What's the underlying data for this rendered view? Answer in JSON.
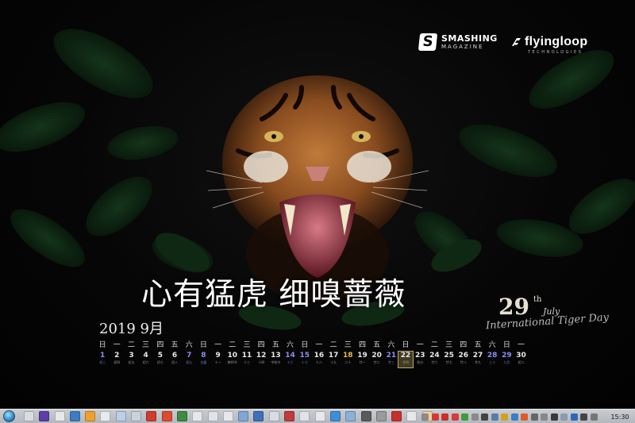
{
  "wallpaper": {
    "slogan": "心有猛虎 细嗅蔷薇",
    "logos": {
      "smashing_mark": "S",
      "smashing_line1": "SMASHING",
      "smashing_line2": "MAGAZINE",
      "flyingloop_name": "flyingloop",
      "flyingloop_tagline": "TECHNOLOGIES"
    },
    "tiger_day": {
      "number": "29",
      "suffix": "th",
      "month": "July",
      "caption": "International Tiger Day"
    }
  },
  "calendar": {
    "title": "2019 9月",
    "weekdays": [
      "日",
      "一",
      "二",
      "三",
      "四",
      "五",
      "六",
      "日",
      "一",
      "二",
      "三",
      "四",
      "五",
      "六",
      "日",
      "一",
      "二",
      "三",
      "四",
      "五",
      "六",
      "日",
      "一",
      "二",
      "三",
      "四",
      "五",
      "六",
      "日",
      "一"
    ],
    "days": [
      {
        "n": "1",
        "s": "初三",
        "weekend": true
      },
      {
        "n": "2",
        "s": "初四"
      },
      {
        "n": "3",
        "s": "初五"
      },
      {
        "n": "4",
        "s": "初六"
      },
      {
        "n": "5",
        "s": "初七"
      },
      {
        "n": "6",
        "s": "初八"
      },
      {
        "n": "7",
        "s": "初九",
        "weekend": true
      },
      {
        "n": "8",
        "s": "白露",
        "weekend": true
      },
      {
        "n": "9",
        "s": "十一"
      },
      {
        "n": "10",
        "s": "教师节"
      },
      {
        "n": "11",
        "s": "十三"
      },
      {
        "n": "12",
        "s": "十四"
      },
      {
        "n": "13",
        "s": "中秋节"
      },
      {
        "n": "14",
        "s": "十六",
        "weekend": true
      },
      {
        "n": "15",
        "s": "十七",
        "weekend": true
      },
      {
        "n": "16",
        "s": "十八"
      },
      {
        "n": "17",
        "s": "十九"
      },
      {
        "n": "18",
        "s": "二十",
        "holiday": true
      },
      {
        "n": "19",
        "s": "廿一"
      },
      {
        "n": "20",
        "s": "廿二"
      },
      {
        "n": "21",
        "s": "廿三",
        "weekend": true
      },
      {
        "n": "22",
        "s": "廿四",
        "today": true
      },
      {
        "n": "23",
        "s": "秋分"
      },
      {
        "n": "24",
        "s": "廿六"
      },
      {
        "n": "25",
        "s": "廿七"
      },
      {
        "n": "26",
        "s": "廿八"
      },
      {
        "n": "27",
        "s": "廿九"
      },
      {
        "n": "28",
        "s": "三十",
        "weekend": true
      },
      {
        "n": "29",
        "s": "九月",
        "weekend": true
      },
      {
        "n": "30",
        "s": "初二"
      }
    ]
  },
  "taskbar": {
    "clock": "15:30",
    "app_icon_colors": [
      "#d9dde2",
      "#5b3fa6",
      "#e6e8eb",
      "#3b7cc4",
      "#f0a02a",
      "#e9eaec",
      "#b8d0e8",
      "#c9d3de",
      "#d23b2e",
      "#e04a2e",
      "#3f8a3f",
      "#e6e8eb",
      "#dfe3e8",
      "#e6e8eb",
      "#7fa7d6",
      "#3e6fb8",
      "#d8dde3",
      "#c23a3a",
      "#dfe3e8",
      "#e6e8eb",
      "#3d8fd6",
      "#8bb0d9",
      "#5a5a5a",
      "#9a9a9a",
      "#c8302a",
      "#e8e8e8",
      "#f0d0a0"
    ],
    "tray_icon_colors": [
      "#8a8a8a",
      "#d43b2e",
      "#c9302a",
      "#d93a3a",
      "#3f9a3f",
      "#8a8a8a",
      "#444",
      "#5a7da8",
      "#d0a020",
      "#3b7cc4",
      "#e05a28",
      "#666",
      "#888",
      "#3a3a3a",
      "#8a9ab0",
      "#2a6ab8",
      "#444",
      "#777"
    ]
  }
}
